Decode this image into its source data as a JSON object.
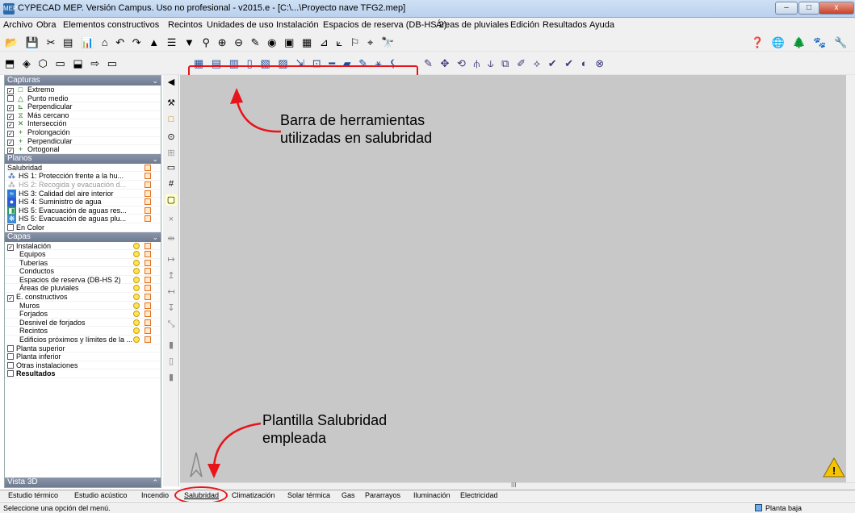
{
  "window": {
    "title": "CYPECAD MEP. Versión Campus. Uso no profesional - v2015.e - [C:\\...\\Proyecto nave TFG2.mep]",
    "app_icon": "MEP",
    "controls": {
      "minimize": "–",
      "maximize": "□",
      "close": "x"
    }
  },
  "menubar": [
    {
      "label": "Archivo"
    },
    {
      "label": "Obra"
    },
    {
      "label": "Elementos constructivos"
    },
    {
      "label": "Recintos"
    },
    {
      "label": "Unidades de uso"
    },
    {
      "label": "Instalación"
    },
    {
      "label": "Espacios de reserva (DB-HS 2)"
    },
    {
      "label": "Áreas de pluviales"
    },
    {
      "label": "Edición"
    },
    {
      "label": "Resultados"
    },
    {
      "label": "Ayuda"
    }
  ],
  "toolbar1": {
    "icons": "📂 💾 ✂ ▤ 📊 ⌂ ↶ ↷ ▲ ☰ ▼ ⚲ ⊕ ⊖ ✎ ◉ ▣ ▦ ⊿ ⟀ ⚐ ⌖ 🔭",
    "right_icons": "❓ 🌐 🌲 🐾 🔧"
  },
  "toolbar2": {
    "left_icons": "⬒ ◈ ⬡ ▭ ⬓ ⇨ ▭",
    "highlighted_icons": "▦ ▤ ▥ ▯ ▧ ▨ ⇲ ⊡ ━ ▰ ✎ ⚹ ⚸",
    "right_icons": "✎ ✥ ⟲ ⫛ ⫝ ⧉ ✐ ⟡ ✔ ✔ ◐ ⊗"
  },
  "panels": {
    "capturas": {
      "title": "Capturas",
      "items": [
        {
          "label": "Extremo",
          "checked": true,
          "icon": "□"
        },
        {
          "label": "Punto medio",
          "checked": false,
          "icon": "△"
        },
        {
          "label": "Perpendicular",
          "checked": true,
          "icon": "⊾"
        },
        {
          "label": "Más cercano",
          "checked": true,
          "icon": "⧖"
        },
        {
          "label": "Intersección",
          "checked": true,
          "icon": "✕"
        },
        {
          "label": "Prolongación",
          "checked": true,
          "icon": "+"
        },
        {
          "label": "Perpendicular",
          "checked": true,
          "icon": "+"
        },
        {
          "label": "Ortogonal",
          "checked": true,
          "icon": "+"
        }
      ]
    },
    "planos": {
      "title": "Planos",
      "group": "Salubridad",
      "items": [
        {
          "label": "HS 1: Protección frente a la hu...",
          "enabled": true
        },
        {
          "label": "HS 2: Recogida y evacuación d...",
          "enabled": false
        },
        {
          "label": "HS 3: Calidad del aire interior",
          "enabled": true
        },
        {
          "label": "HS 4: Suministro de agua",
          "enabled": true
        },
        {
          "label": "HS 5: Evacuación de aguas res...",
          "enabled": true
        },
        {
          "label": "HS 5: Evacuación de aguas plu...",
          "enabled": true
        }
      ],
      "en_color": "En Color"
    },
    "capas": {
      "title": "Capas",
      "items": [
        {
          "label": "Instalación",
          "checked": true,
          "indent": 0
        },
        {
          "label": "Equipos",
          "indent": 1
        },
        {
          "label": "Tuberías",
          "indent": 1
        },
        {
          "label": "Conductos",
          "indent": 1
        },
        {
          "label": "Espacios de reserva (DB-HS 2)",
          "indent": 1
        },
        {
          "label": "Áreas de pluviales",
          "indent": 1
        },
        {
          "label": "E. constructivos",
          "checked": true,
          "indent": 0
        },
        {
          "label": "Muros",
          "indent": 1
        },
        {
          "label": "Forjados",
          "indent": 1
        },
        {
          "label": "Desnivel de forjados",
          "indent": 1
        },
        {
          "label": "Recintos",
          "indent": 1
        },
        {
          "label": "Edificios próximos y límites de la ...",
          "indent": 1
        },
        {
          "label": "Planta superior",
          "checked": false,
          "indent": 0
        },
        {
          "label": "Planta inferior",
          "checked": false,
          "indent": 0
        },
        {
          "label": "Otras instalaciones",
          "checked": false,
          "indent": 0
        },
        {
          "label": "Resultados",
          "checked": false,
          "indent": 0,
          "bold": true
        }
      ]
    },
    "vista3d": {
      "title": "Vista 3D"
    }
  },
  "annotations": {
    "toolbar_note_line1": "Barra de herramientas",
    "toolbar_note_line2": "utilizadas en salubridad",
    "template_note_line1": "Plantilla Salubridad",
    "template_note_line2": "empleada",
    "color": "#e8141a"
  },
  "tabs": [
    {
      "label": "Estudio térmico"
    },
    {
      "label": "Estudio acústico"
    },
    {
      "label": "Incendio"
    },
    {
      "label": "Salubridad",
      "active": true
    },
    {
      "label": "Climatización"
    },
    {
      "label": "Solar térmica"
    },
    {
      "label": "Gas"
    },
    {
      "label": "Pararrayos"
    },
    {
      "label": "Iluminación"
    },
    {
      "label": "Electricidad"
    }
  ],
  "status": {
    "message": "Seleccione una opción del menú.",
    "floor": "Planta baja"
  },
  "scroll_marker": "III"
}
